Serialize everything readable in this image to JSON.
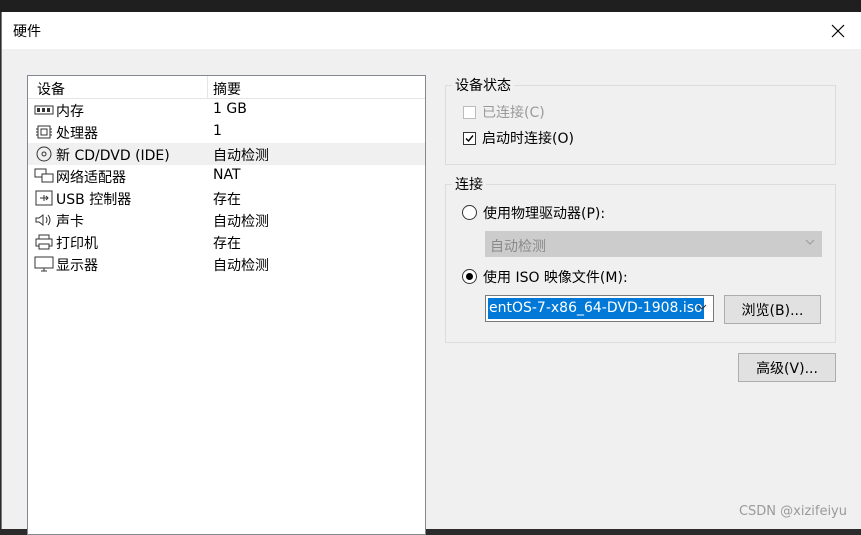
{
  "window": {
    "title": "硬件"
  },
  "device_list": {
    "columns": [
      "设备",
      "摘要"
    ],
    "rows": [
      {
        "name": "内存",
        "summary": "1 GB",
        "icon": "memory-icon"
      },
      {
        "name": "处理器",
        "summary": "1",
        "icon": "processor-icon"
      },
      {
        "name": "新 CD/DVD (IDE)",
        "summary": "自动检测",
        "icon": "cd-dvd-icon",
        "selected": true
      },
      {
        "name": "网络适配器",
        "summary": "NAT",
        "icon": "network-icon"
      },
      {
        "name": "USB 控制器",
        "summary": "存在",
        "icon": "usb-icon"
      },
      {
        "name": "声卡",
        "summary": "自动检测",
        "icon": "speaker-icon"
      },
      {
        "name": "打印机",
        "summary": "存在",
        "icon": "printer-icon"
      },
      {
        "name": "显示器",
        "summary": "自动检测",
        "icon": "monitor-icon"
      }
    ]
  },
  "device_status": {
    "title": "设备状态",
    "connected_label": "已连接(C)",
    "connected_checked": false,
    "connected_disabled": true,
    "connect_at_power_on_label": "启动时连接(O)",
    "connect_at_power_on_checked": true
  },
  "connection": {
    "title": "连接",
    "physical_drive_label": "使用物理驱动器(P):",
    "physical_drive_value": "自动检测",
    "iso_label": "使用 ISO 映像文件(M):",
    "iso_value": "entOS-7-x86_64-DVD-1908.iso",
    "browse_label": "浏览(B)...",
    "selected_option": "iso"
  },
  "advanced_label": "高级(V)...",
  "watermark": "CSDN @xizifeiyu",
  "colors": {
    "selection": "#0078d7",
    "dialog_bg": "#f0f0f0"
  }
}
